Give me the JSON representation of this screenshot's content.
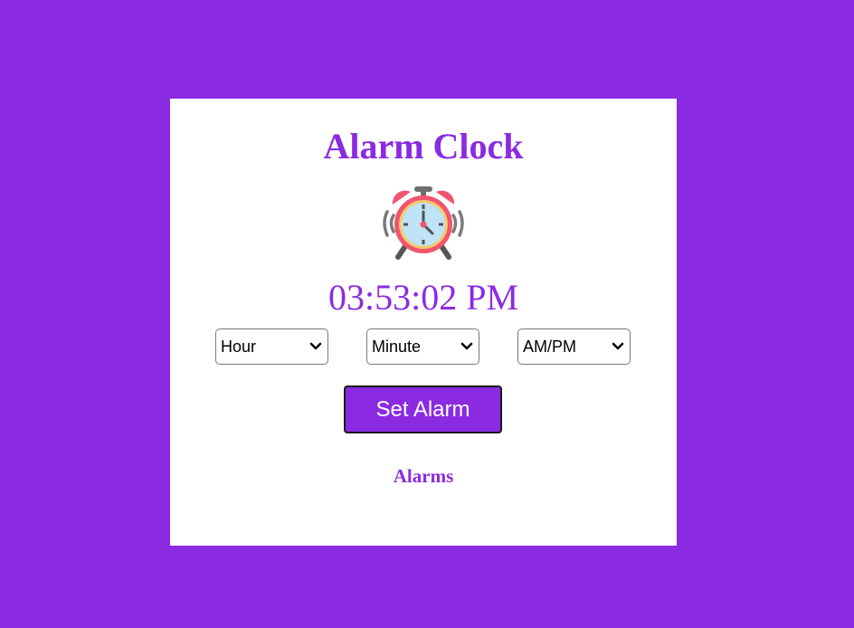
{
  "colors": {
    "background": "#8a2be2",
    "accent": "#8a2be2",
    "card": "#ffffff"
  },
  "app": {
    "title": "Alarm Clock",
    "icon": "alarm-clock-icon"
  },
  "clock": {
    "time": "03:53:02 PM"
  },
  "selects": {
    "hour": {
      "value": "Hour",
      "icon": "chevron-down-icon"
    },
    "minute": {
      "value": "Minute",
      "icon": "chevron-down-icon"
    },
    "ampm": {
      "value": "AM/PM",
      "icon": "chevron-down-icon"
    }
  },
  "actions": {
    "set_alarm_label": "Set Alarm"
  },
  "alarms": {
    "heading": "Alarms"
  }
}
